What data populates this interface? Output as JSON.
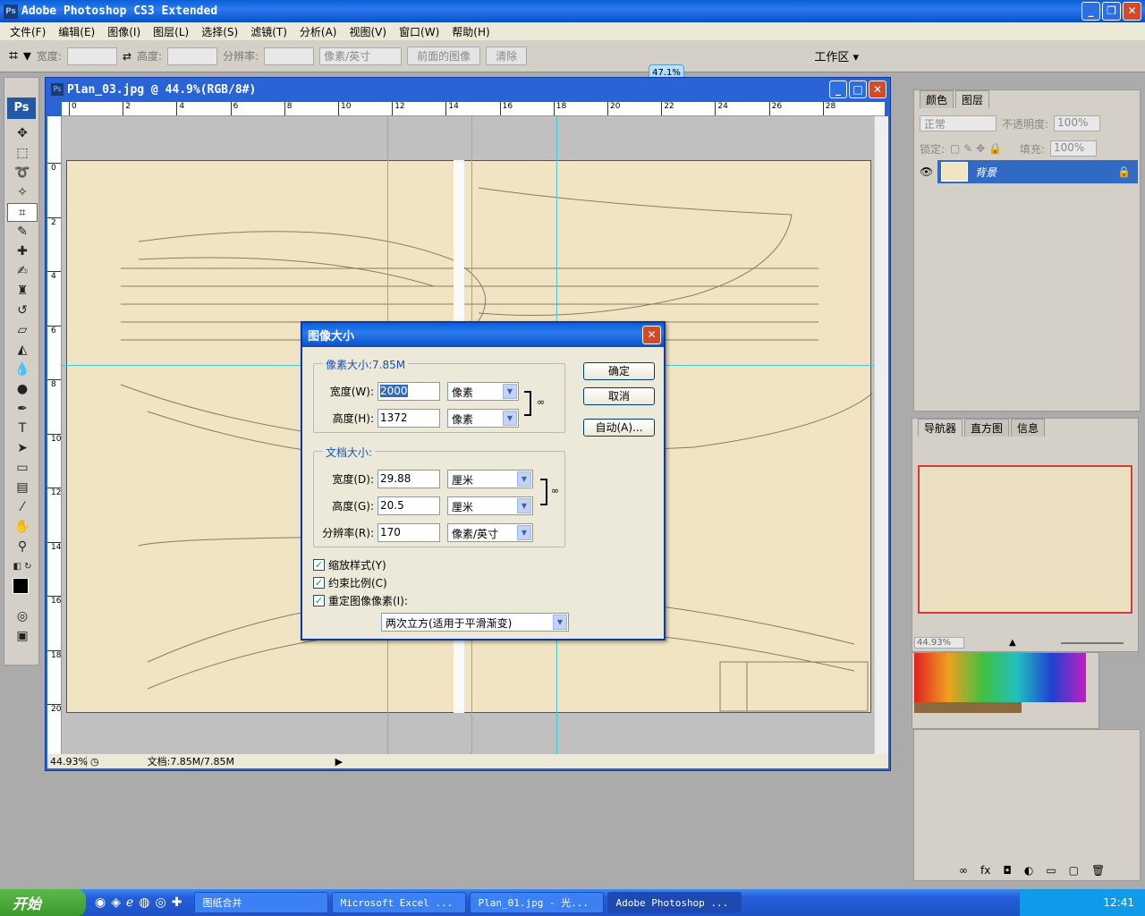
{
  "app": {
    "title": "Adobe Photoshop CS3 Extended",
    "logo": "Ps"
  },
  "menu": [
    "文件(F)",
    "编辑(E)",
    "图像(I)",
    "图层(L)",
    "选择(S)",
    "滤镜(T)",
    "分析(A)",
    "视图(V)",
    "窗口(W)",
    "帮助(H)"
  ],
  "options": {
    "width_label": "宽度:",
    "height_label": "高度:",
    "resolution_label": "分辨率:",
    "unit": "像素/英寸",
    "front_image": "前面的图像",
    "clear": "清除",
    "workspace": "工作区 ▾"
  },
  "zoom_tip": "47.1%",
  "document": {
    "title": "Plan_03.jpg @ 44.9%(RGB/8#)",
    "ruler_h": [
      "0",
      "2",
      "4",
      "6",
      "8",
      "10",
      "12",
      "14",
      "16",
      "18",
      "20",
      "22",
      "24",
      "26",
      "28"
    ],
    "ruler_v": [
      "0",
      "2",
      "4",
      "6",
      "8",
      "10",
      "12",
      "14",
      "16",
      "18",
      "20"
    ],
    "status_zoom": "44.93%",
    "status_doc": "文档:7.85M/7.85M"
  },
  "dialog": {
    "title": "图像大小",
    "pixel_group": "像素大小:7.85M",
    "width_label": "宽度(W):",
    "width_value": "2000",
    "width_unit": "像素",
    "height_label": "高度(H):",
    "height_value": "1372",
    "height_unit": "像素",
    "doc_group": "文档大小:",
    "doc_width_label": "宽度(D):",
    "doc_width_value": "29.88",
    "doc_width_unit": "厘米",
    "doc_height_label": "高度(G):",
    "doc_height_value": "20.5",
    "doc_height_unit": "厘米",
    "res_label": "分辨率(R):",
    "res_value": "170",
    "res_unit": "像素/英寸",
    "ok": "确定",
    "cancel": "取消",
    "auto": "自动(A)...",
    "scale_styles": "缩放样式(Y)",
    "constrain": "约束比例(C)",
    "resample": "重定图像像素(I):",
    "resample_method": "两次立方(适用于平滑渐变)"
  },
  "layers_panel": {
    "tabs": [
      "颜色",
      "图层"
    ],
    "blend": "正常",
    "opacity_label": "不透明度:",
    "opacity": "100%",
    "lock_label": "锁定:",
    "fill_label": "填充:",
    "fill": "100%",
    "layer_name": "背景"
  },
  "navigator_panel": {
    "tabs": [
      "导航器",
      "直方图",
      "信息"
    ],
    "zoom": "44.93%"
  },
  "taskbar": {
    "start": "开始",
    "tasks": [
      "图纸合并",
      "Microsoft Excel ...",
      "Plan_01.jpg - 光...",
      "Adobe Photoshop ..."
    ],
    "time": "12:41"
  }
}
